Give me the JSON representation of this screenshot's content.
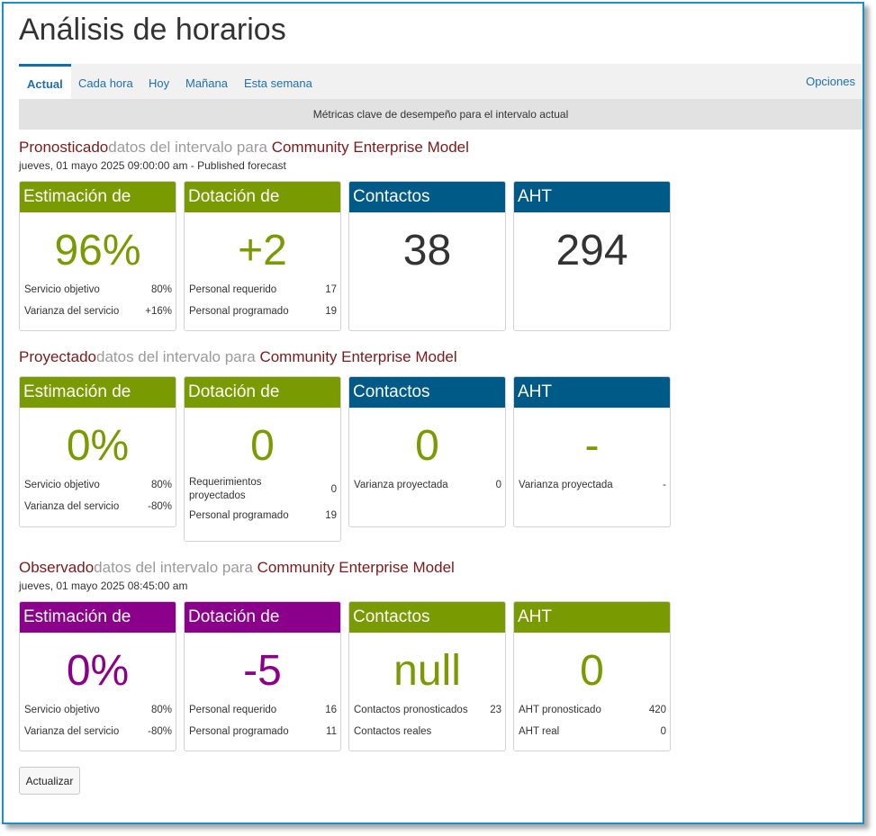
{
  "title": "Análisis de horarios",
  "tabs": [
    {
      "label": "Actual",
      "active": true
    },
    {
      "label": "Cada hora",
      "active": false
    },
    {
      "label": "Hoy",
      "active": false
    },
    {
      "label": "Mañana",
      "active": false
    },
    {
      "label": "Esta semana",
      "active": false
    }
  ],
  "options_label": "Opciones",
  "subheader": "Métricas clave de desempeño para el intervalo actual",
  "colors": {
    "green": "#7a9a01",
    "blue": "#005a87",
    "purple": "#8b008b",
    "dark_value": "#333333",
    "title_red": "#7b1a1a",
    "tab_blue": "#1f6fb2"
  },
  "sections": [
    {
      "prefix": "Pronosticado",
      "mid": "datos del intervalo para ",
      "model": "Community Enterprise Model",
      "subtitle": "jueves, 01 mayo 2025 09:00:00 am - Published forecast",
      "cards": [
        {
          "header": "Estimación de",
          "value": "96%",
          "rows": [
            {
              "label": "Servicio objetivo",
              "value": "80%"
            },
            {
              "label": "Varianza del servicio",
              "value": "+16%"
            }
          ]
        },
        {
          "header": "Dotación de",
          "value": "+2",
          "rows": [
            {
              "label": "Personal requerido",
              "value": "17"
            },
            {
              "label": "Personal programado",
              "value": "19"
            }
          ]
        },
        {
          "header": "Contactos",
          "value": "38",
          "rows": []
        },
        {
          "header": "AHT",
          "value": "294",
          "rows": []
        }
      ]
    },
    {
      "prefix": "Proyectado",
      "mid": "datos del intervalo para ",
      "model": "Community Enterprise Model",
      "subtitle": "",
      "cards": [
        {
          "header": "Estimación de",
          "value": "0%",
          "rows": [
            {
              "label": "Servicio objetivo",
              "value": "80%"
            },
            {
              "label": "Varianza del servicio",
              "value": "-80%"
            }
          ]
        },
        {
          "header": "Dotación de",
          "value": "0",
          "rows": [
            {
              "label": "Requerimientos proyectados",
              "value": "0"
            },
            {
              "label": "Personal programado",
              "value": "19"
            }
          ]
        },
        {
          "header": "Contactos",
          "value": "0",
          "rows": [
            {
              "label": "Varianza proyectada",
              "value": "0"
            }
          ]
        },
        {
          "header": "AHT",
          "value": "-",
          "rows": [
            {
              "label": "Varianza proyectada",
              "value": "-"
            }
          ]
        }
      ]
    },
    {
      "prefix": "Observado",
      "mid": "datos del intervalo para ",
      "model": "Community Enterprise Model",
      "subtitle": "jueves, 01 mayo 2025 08:45:00 am",
      "cards": [
        {
          "header": "Estimación de",
          "value": "0%",
          "rows": [
            {
              "label": "Servicio objetivo",
              "value": "80%"
            },
            {
              "label": "Varianza del servicio",
              "value": "-80%"
            }
          ]
        },
        {
          "header": "Dotación de",
          "value": "-5",
          "rows": [
            {
              "label": "Personal requerido",
              "value": "16"
            },
            {
              "label": "Personal programado",
              "value": "11"
            }
          ]
        },
        {
          "header": "Contactos",
          "value": "null",
          "rows": [
            {
              "label": "Contactos pronosticados",
              "value": "23"
            },
            {
              "label": "Contactos reales",
              "value": ""
            }
          ]
        },
        {
          "header": "AHT",
          "value": "0",
          "rows": [
            {
              "label": "AHT pronosticado",
              "value": "420"
            },
            {
              "label": "AHT real",
              "value": "0"
            }
          ]
        }
      ]
    }
  ],
  "update_button": "Actualizar"
}
